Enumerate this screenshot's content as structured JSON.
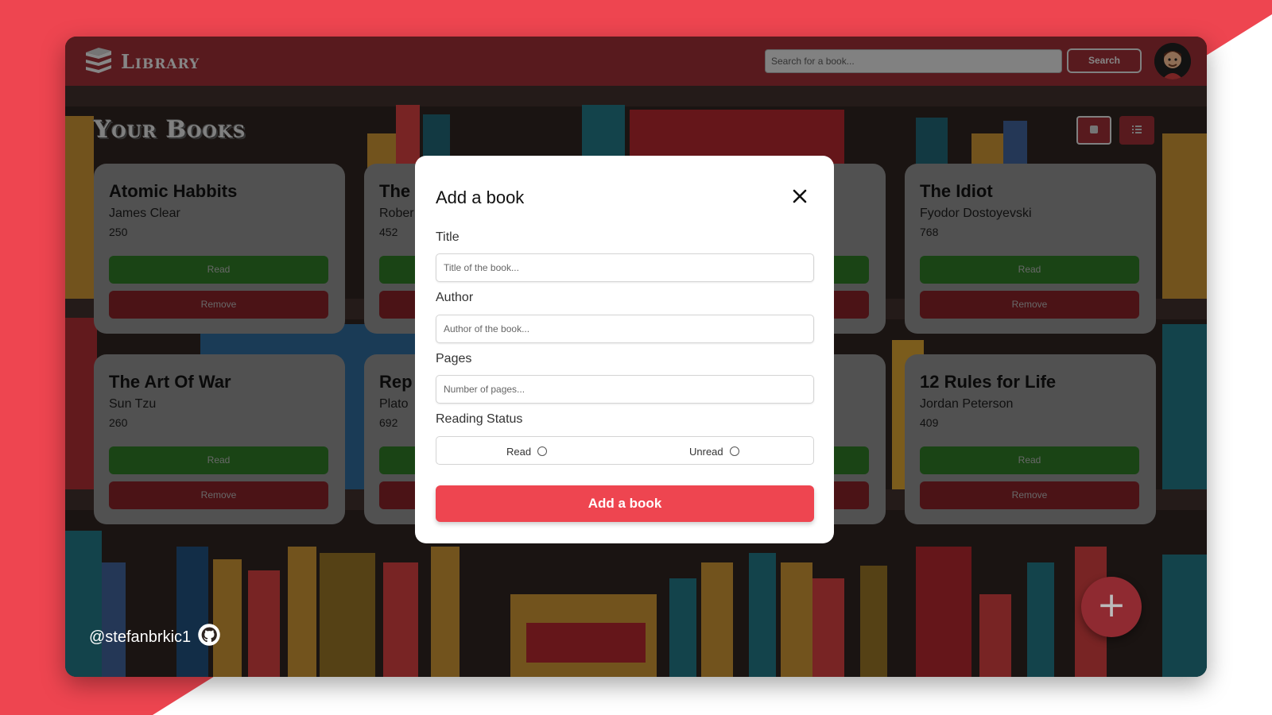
{
  "app": {
    "title": "Library",
    "brand_color": "#8f2a31",
    "accent": "#ee4550"
  },
  "header": {
    "logo_icon": "books-stack-icon",
    "search": {
      "placeholder": "Search for a book...",
      "button_label": "Search"
    },
    "avatar_icon": "user-avatar-icon"
  },
  "main": {
    "title": "Your Books",
    "view_buttons": [
      {
        "icon": "grid-view-icon"
      },
      {
        "icon": "list-view-icon"
      }
    ]
  },
  "books": [
    {
      "title": "Atomic Habbits",
      "author": "James Clear",
      "pages": "250",
      "read_label": "Read",
      "remove_label": "Remove"
    },
    {
      "title": "The",
      "author": "Rober",
      "pages": "452",
      "read_label": "Read",
      "remove_label": "Remove"
    },
    {
      "title": "The Idiot",
      "author": "Fyodor Dostoyevski",
      "pages": "768",
      "read_label": "Read",
      "remove_label": "Remove"
    },
    {
      "title": "The Art Of War",
      "author": "Sun Tzu",
      "pages": "260",
      "read_label": "Read",
      "remove_label": "Remove"
    },
    {
      "title": "Rep",
      "author": "Plato",
      "pages": "692",
      "read_label": "Read",
      "remove_label": "Remove"
    },
    {
      "title": "12 Rules for Life",
      "author": "Jordan Peterson",
      "pages": "409",
      "read_label": "Read",
      "remove_label": "Remove"
    }
  ],
  "modal": {
    "title": "Add a book",
    "close_icon": "close-icon",
    "fields": {
      "title": {
        "label": "Title",
        "placeholder": "Title of the book..."
      },
      "author": {
        "label": "Author",
        "placeholder": "Author of the book..."
      },
      "pages": {
        "label": "Pages",
        "placeholder": "Number of pages..."
      }
    },
    "status": {
      "label": "Reading Status",
      "options": [
        "Read",
        "Unread"
      ]
    },
    "submit_label": "Add a book"
  },
  "fab": {
    "icon": "plus-icon",
    "label": "+"
  },
  "footer": {
    "handle": "@stefanbrkic1",
    "icon": "github-icon"
  }
}
